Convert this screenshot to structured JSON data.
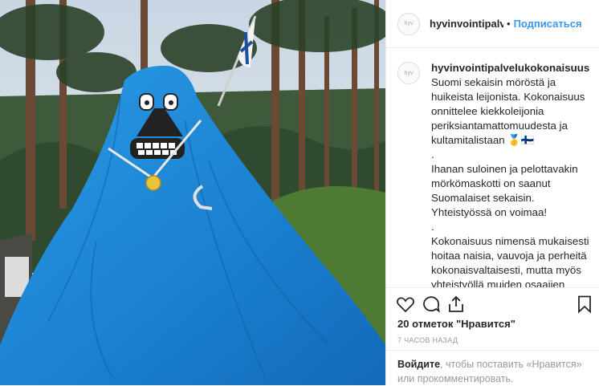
{
  "post": {
    "username": "hyvinvointipalvelukokonaisuus",
    "header_username": "hyvinvointipalvel",
    "separator": "•",
    "follow_label": "Подписаться",
    "avatar_text": "hyv",
    "caption_user": "hyvinvointipalvelukokonaisuus",
    "caption": "Suomi sekaisin möröstä ja huikeista leijonista. Kokonaisuus onnittelee kiekkoleijonia periksiantamattomuudesta ja kultamitalistaan 🥇🇫🇮\n.\nIhanan suloinen ja pelottavakin mörkömaskotti on saanut Suomalaiset sekaisin. Yhteistyössä on voimaa!\n.\nKokonaisuus nimensä mukaisesti hoitaa naisia, vauvoja ja perheitä kokonaisvaltaisesti, mutta myös yhteistyöllä muiden osaajien kanssa jotta lopputulos olisi mahdollisimman hyvä, yksilöllinen",
    "likes": "20 отметок \"Нравится\"",
    "time_ago": "7 ЧАСОВ НАЗАД",
    "login_link": "Войдите",
    "login_rest": ", чтобы поставить «Нравится» или прокомментировать."
  },
  "icons": [
    "heart-icon",
    "comment-icon",
    "share-icon",
    "bookmark-icon"
  ],
  "colors": {
    "link_blue": "#3897f0",
    "tarp_blue": "#1e8ad6",
    "text": "#262626",
    "muted": "#999999"
  }
}
